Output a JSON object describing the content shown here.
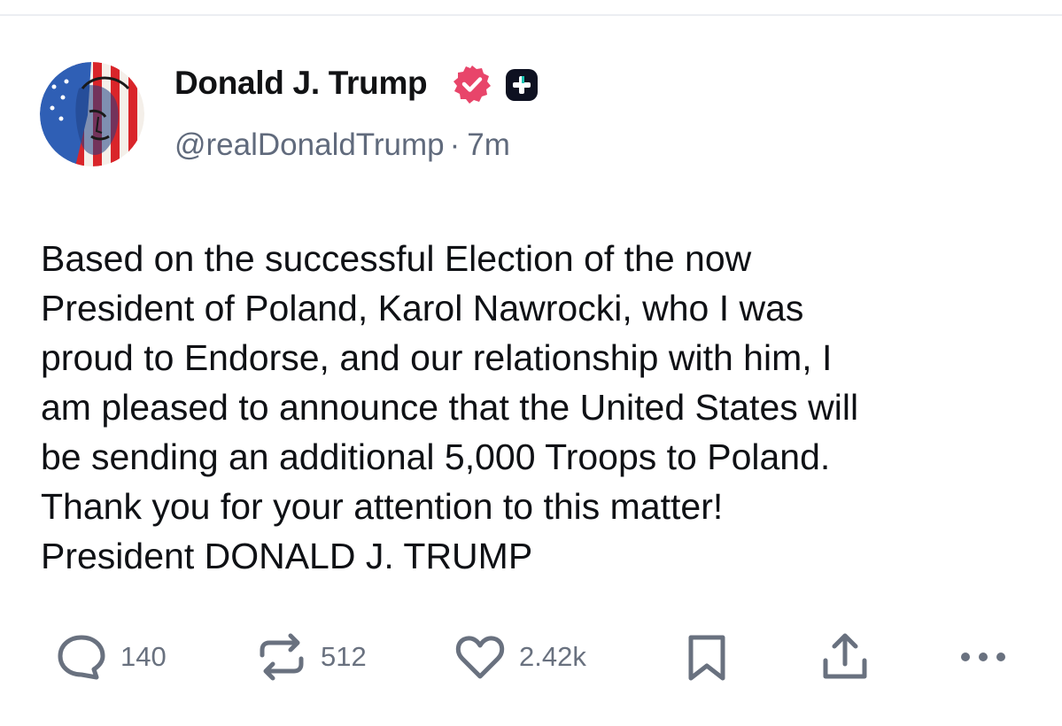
{
  "author": {
    "display_name": "Donald J. Trump",
    "handle": "@realDonaldTrump",
    "separator": "·",
    "time_ago": "7m",
    "avatar_icon": "avatar-portrait-flag",
    "verified_icon": "verified-badge-icon",
    "plus_icon": "plus-badge-icon"
  },
  "post": {
    "lines": [
      "Based on the successful Election of the now",
      "President of Poland, Karol Nawrocki, who I was",
      "proud to Endorse, and our relationship with him, I",
      "am pleased to announce that the United States will",
      "be sending an additional 5,000 Troops to Poland.",
      "Thank you for your attention to this matter!",
      "President DONALD J. TRUMP"
    ]
  },
  "actions": {
    "reply": {
      "icon": "reply-bubble-icon",
      "count": "140"
    },
    "retruth": {
      "icon": "repost-icon",
      "count": "512"
    },
    "like": {
      "icon": "heart-icon",
      "count": "2.42k"
    },
    "bookmark": {
      "icon": "bookmark-icon"
    },
    "share": {
      "icon": "share-icon"
    },
    "more": {
      "icon": "more-dots-icon"
    }
  },
  "colors": {
    "verified": "#E8456A",
    "plus_badge": "#0E1121",
    "text": "#0F1115",
    "muted": "#606A7C",
    "icon": "#69717F"
  }
}
